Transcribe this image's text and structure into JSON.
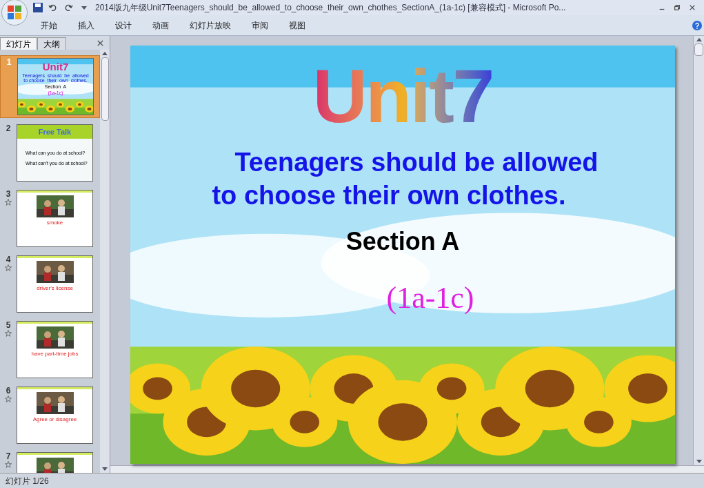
{
  "window": {
    "title": "2014版九年级Unit7Teenagers_should_be_allowed_to_choose_their_own_chothes_SectionA_(1a-1c) [兼容模式] - Microsoft Po..."
  },
  "ribbon_tabs": [
    {
      "label": "开始",
      "selected": false
    },
    {
      "label": "插入",
      "selected": false
    },
    {
      "label": "设计",
      "selected": false
    },
    {
      "label": "动画",
      "selected": false
    },
    {
      "label": "幻灯片放映",
      "selected": false
    },
    {
      "label": "审阅",
      "selected": false
    },
    {
      "label": "视图",
      "selected": false
    }
  ],
  "pane_tabs": [
    {
      "label": "幻灯片",
      "selected": true
    },
    {
      "label": "大纲",
      "selected": false
    }
  ],
  "slides": [
    {
      "number": "1",
      "selected": true,
      "animated": false,
      "kind": "title",
      "texts": [
        "Unit7",
        "Teenagers  should  be  allowed",
        "to choose  their  own  clothes.",
        "Section  A",
        "(1a-1c)"
      ]
    },
    {
      "number": "2",
      "selected": false,
      "animated": false,
      "kind": "talk",
      "texts": [
        "Free Talk",
        "What can you do at school?",
        "What can't you do at school?"
      ]
    },
    {
      "number": "3",
      "selected": false,
      "animated": true,
      "texts": [
        "smoke"
      ]
    },
    {
      "number": "4",
      "selected": false,
      "animated": true,
      "texts": [
        "driver's license"
      ]
    },
    {
      "number": "5",
      "selected": false,
      "animated": true,
      "texts": [
        "have part-time jobs"
      ]
    },
    {
      "number": "6",
      "selected": false,
      "animated": true,
      "texts": [
        "Agree or disagree"
      ]
    },
    {
      "number": "7",
      "selected": false,
      "animated": true
    }
  ],
  "slide": {
    "title": "Unit7",
    "subtitle_lines": [
      "Teenagers should be allowed",
      "to choose their own clothes."
    ],
    "section": "Section A",
    "range": "(1a-1c)"
  },
  "status_bar": {
    "slide_counter": "幻灯片 1/26"
  }
}
